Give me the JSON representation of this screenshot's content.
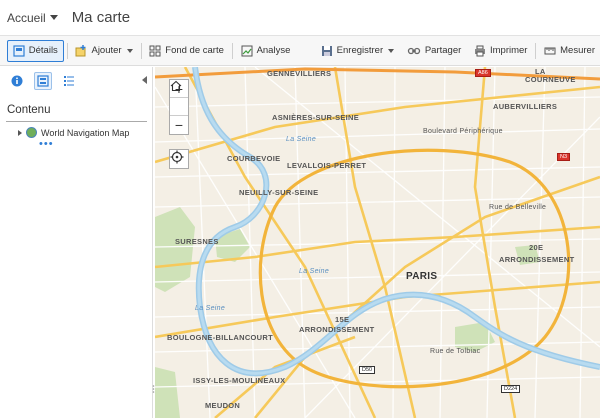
{
  "header": {
    "home_label": "Accueil",
    "map_title": "Ma carte"
  },
  "toolbar": {
    "details": "Détails",
    "add": "Ajouter",
    "basemap": "Fond de carte",
    "analysis": "Analyse",
    "save": "Enregistrer",
    "share": "Partager",
    "print": "Imprimer",
    "measure": "Mesurer"
  },
  "panel": {
    "heading": "Contenu",
    "layers": [
      {
        "name": "World Navigation Map"
      }
    ],
    "more": "•••"
  },
  "map": {
    "labels": {
      "gennevilliers": "GENNEVILLIERS",
      "courneuve": "COURNEUVE",
      "la": "LA",
      "asnieres": "ASNIÈRES-SUR-SEINE",
      "aubervilliers": "AUBERVILLIERS",
      "boulevard": "Boulevard Périphérique",
      "courbevoie": "COURBEVOIE",
      "levallois": "LEVALLOIS-PERRET",
      "neuilly": "NEUILLY-SUR-SEINE",
      "belleville": "Rue de Belleville",
      "suresnes": "SURESNES",
      "seine1": "La Seine",
      "seine2": "La Seine",
      "seine3": "La Seine",
      "paris": "PARIS",
      "arr20_num": "20E",
      "arr20": "ARRONDISSEMENT",
      "arr15_num": "15E",
      "arr15": "ARRONDISSEMENT",
      "boulogne": "BOULOGNE-BILLANCOURT",
      "tolbiac": "Rue de Tolbiac",
      "issy": "ISSY-LES-MOULINEAUX",
      "meudon": "MEUDON"
    },
    "shields": {
      "a86": "A86",
      "n3": "N3",
      "d50": "D50",
      "d224": "D224"
    }
  }
}
